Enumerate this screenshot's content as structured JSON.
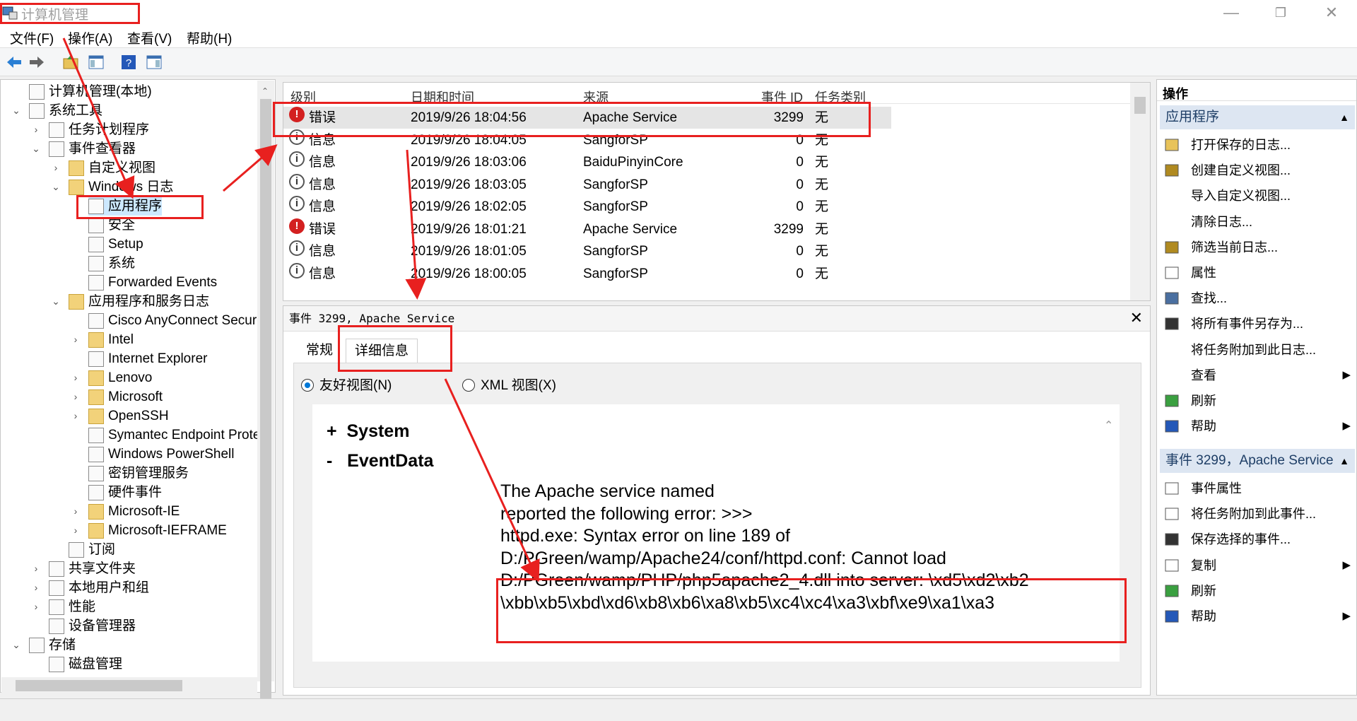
{
  "window": {
    "title": "计算机管理",
    "minimize": "—",
    "restore": "❐",
    "close": "✕"
  },
  "menu": [
    "文件(F)",
    "操作(A)",
    "查看(V)",
    "帮助(H)"
  ],
  "toolbar": {
    "back": "back-arrow-icon",
    "forward": "forward-arrow-icon",
    "up": "folder-up-icon",
    "console": "console-tree-icon",
    "help": "help-icon",
    "view": "view-pane-icon"
  },
  "tree": [
    {
      "label": "计算机管理(本地)",
      "level": 0,
      "icon": "computer-management-icon",
      "chev": ""
    },
    {
      "label": "系统工具",
      "level": 0,
      "icon": "tools-icon",
      "chev": "⌄"
    },
    {
      "label": "任务计划程序",
      "level": 1,
      "icon": "clock-icon",
      "chev": "›"
    },
    {
      "label": "事件查看器",
      "level": 1,
      "icon": "event-viewer-icon",
      "chev": "⌄"
    },
    {
      "label": "自定义视图",
      "level": 2,
      "icon": "folder-icon",
      "chev": "›"
    },
    {
      "label": "Windows 日志",
      "level": 2,
      "icon": "folder-icon",
      "chev": "⌄"
    },
    {
      "label": "应用程序",
      "level": 3,
      "icon": "log-icon",
      "chev": "",
      "selected": true
    },
    {
      "label": "安全",
      "level": 3,
      "icon": "log-icon",
      "chev": ""
    },
    {
      "label": "Setup",
      "level": 3,
      "icon": "log-icon",
      "chev": ""
    },
    {
      "label": "系统",
      "level": 3,
      "icon": "log-icon",
      "chev": ""
    },
    {
      "label": "Forwarded Events",
      "level": 3,
      "icon": "log-icon",
      "chev": ""
    },
    {
      "label": "应用程序和服务日志",
      "level": 2,
      "icon": "folder-icon",
      "chev": "⌄"
    },
    {
      "label": "Cisco AnyConnect Secure",
      "level": 3,
      "icon": "log-icon",
      "chev": ""
    },
    {
      "label": "Intel",
      "level": 3,
      "icon": "folder-icon",
      "chev": "›"
    },
    {
      "label": "Internet Explorer",
      "level": 3,
      "icon": "log-icon",
      "chev": ""
    },
    {
      "label": "Lenovo",
      "level": 3,
      "icon": "folder-icon",
      "chev": "›"
    },
    {
      "label": "Microsoft",
      "level": 3,
      "icon": "folder-icon",
      "chev": "›"
    },
    {
      "label": "OpenSSH",
      "level": 3,
      "icon": "folder-icon",
      "chev": "›"
    },
    {
      "label": "Symantec Endpoint Protec",
      "level": 3,
      "icon": "log-icon",
      "chev": ""
    },
    {
      "label": "Windows PowerShell",
      "level": 3,
      "icon": "log-icon",
      "chev": ""
    },
    {
      "label": "密钥管理服务",
      "level": 3,
      "icon": "log-icon",
      "chev": ""
    },
    {
      "label": "硬件事件",
      "level": 3,
      "icon": "log-icon",
      "chev": ""
    },
    {
      "label": "Microsoft-IE",
      "level": 3,
      "icon": "folder-icon",
      "chev": "›"
    },
    {
      "label": "Microsoft-IEFRAME",
      "level": 3,
      "icon": "folder-icon",
      "chev": "›"
    },
    {
      "label": "订阅",
      "level": 2,
      "icon": "subscription-icon",
      "chev": ""
    },
    {
      "label": "共享文件夹",
      "level": 1,
      "icon": "shared-folder-icon",
      "chev": "›"
    },
    {
      "label": "本地用户和组",
      "level": 1,
      "icon": "users-icon",
      "chev": "›"
    },
    {
      "label": "性能",
      "level": 1,
      "icon": "performance-icon",
      "chev": "›"
    },
    {
      "label": "设备管理器",
      "level": 1,
      "icon": "device-manager-icon",
      "chev": ""
    },
    {
      "label": "存储",
      "level": 0,
      "icon": "storage-icon",
      "chev": "⌄"
    },
    {
      "label": "磁盘管理",
      "level": 1,
      "icon": "disk-icon",
      "chev": ""
    }
  ],
  "events": {
    "columns": [
      "级别",
      "日期和时间",
      "来源",
      "事件 ID",
      "任务类别"
    ],
    "rows": [
      {
        "level": "错误",
        "type": "error",
        "datetime": "2019/9/26 18:04:56",
        "source": "Apache Service",
        "id": "3299",
        "category": "无",
        "selected": true
      },
      {
        "level": "信息",
        "type": "info",
        "datetime": "2019/9/26 18:04:05",
        "source": "SangforSP",
        "id": "0",
        "category": "无"
      },
      {
        "level": "信息",
        "type": "info",
        "datetime": "2019/9/26 18:03:06",
        "source": "BaiduPinyinCore",
        "id": "0",
        "category": "无"
      },
      {
        "level": "信息",
        "type": "info",
        "datetime": "2019/9/26 18:03:05",
        "source": "SangforSP",
        "id": "0",
        "category": "无"
      },
      {
        "level": "信息",
        "type": "info",
        "datetime": "2019/9/26 18:02:05",
        "source": "SangforSP",
        "id": "0",
        "category": "无"
      },
      {
        "level": "错误",
        "type": "error",
        "datetime": "2019/9/26 18:01:21",
        "source": "Apache Service",
        "id": "3299",
        "category": "无"
      },
      {
        "level": "信息",
        "type": "info",
        "datetime": "2019/9/26 18:01:05",
        "source": "SangforSP",
        "id": "0",
        "category": "无"
      },
      {
        "level": "信息",
        "type": "info",
        "datetime": "2019/9/26 18:00:05",
        "source": "SangforSP",
        "id": "0",
        "category": "无"
      }
    ]
  },
  "detail": {
    "header": "事件 3299, Apache Service",
    "tabs": [
      "常规",
      "详细信息"
    ],
    "radio_friendly": "友好视图(N)",
    "radio_xml": "XML 视图(X)",
    "section_system": "System",
    "section_eventdata": "EventData",
    "message": "The Apache service named\nreported the following error: >>>\nhttpd.exe: Syntax error on line 189 of\nD:/PGreen/wamp/Apache24/conf/httpd.conf: Cannot load\nD:/PGreen/wamp/PHP/php5apache2_4.dll into server: \\xd5\\xd2\\xb2\n\\xbb\\xb5\\xbd\\xd6\\xb8\\xb6\\xa8\\xb5\\xc4\\xc4\\xa3\\xbf\\xe9\\xa1\\xa3"
  },
  "actions": {
    "header": "操作",
    "section1": "应用程序",
    "items1": [
      {
        "label": "打开保存的日志...",
        "icon": "open-log-icon",
        "arrow": ""
      },
      {
        "label": "创建自定义视图...",
        "icon": "filter-icon",
        "arrow": ""
      },
      {
        "label": "导入自定义视图...",
        "icon": "",
        "arrow": ""
      },
      {
        "label": "清除日志...",
        "icon": "",
        "arrow": ""
      },
      {
        "label": "筛选当前日志...",
        "icon": "filter-icon",
        "arrow": ""
      },
      {
        "label": "属性",
        "icon": "properties-icon",
        "arrow": ""
      },
      {
        "label": "查找...",
        "icon": "find-icon",
        "arrow": ""
      },
      {
        "label": "将所有事件另存为...",
        "icon": "save-icon",
        "arrow": ""
      },
      {
        "label": "将任务附加到此日志...",
        "icon": "",
        "arrow": ""
      },
      {
        "label": "查看",
        "icon": "",
        "arrow": "▶"
      },
      {
        "label": "刷新",
        "icon": "refresh-icon",
        "arrow": ""
      },
      {
        "label": "帮助",
        "icon": "help-icon",
        "arrow": "▶"
      }
    ],
    "section2": "事件 3299，Apache Service",
    "items2": [
      {
        "label": "事件属性",
        "icon": "properties-icon",
        "arrow": ""
      },
      {
        "label": "将任务附加到此事件...",
        "icon": "task-icon",
        "arrow": ""
      },
      {
        "label": "保存选择的事件...",
        "icon": "save-icon",
        "arrow": ""
      },
      {
        "label": "复制",
        "icon": "copy-icon",
        "arrow": "▶"
      },
      {
        "label": "刷新",
        "icon": "refresh-icon",
        "arrow": ""
      },
      {
        "label": "帮助",
        "icon": "help-icon",
        "arrow": "▶"
      }
    ]
  },
  "colors": {
    "annotation": "#e8201f",
    "selected": "#cce8ff",
    "section": "#dde6f2"
  }
}
